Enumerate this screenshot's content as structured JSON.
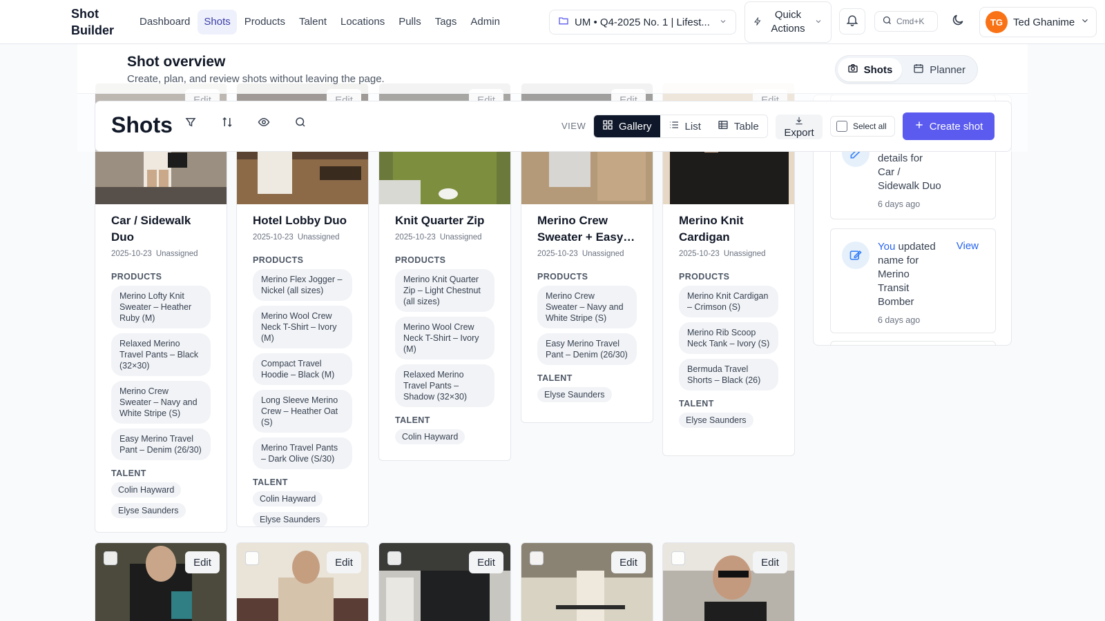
{
  "app": {
    "name": "Shot Builder"
  },
  "nav": {
    "links": [
      "Dashboard",
      "Shots",
      "Products",
      "Talent",
      "Locations",
      "Pulls",
      "Tags",
      "Admin"
    ],
    "active": "Shots"
  },
  "project_selector": {
    "value": "UM • Q4-2025 No. 1 | Lifest..."
  },
  "quick_actions": {
    "label": "Quick Actions"
  },
  "search": {
    "shortcut": "Cmd+K"
  },
  "user": {
    "initials": "TG",
    "name": "Ted Ghanime"
  },
  "page": {
    "title": "Shot overview",
    "subtitle": "Create, plan, and review shots without leaving the page.",
    "mode_shots": "Shots",
    "mode_planner": "Planner"
  },
  "toolbar": {
    "title": "Shots",
    "view_label": "VIEW",
    "views": [
      "Gallery",
      "List",
      "Table"
    ],
    "active_view": "Gallery",
    "export_label": "Export",
    "select_all_label": "Select all",
    "create_label": "Create shot"
  },
  "labels": {
    "products": "PRODUCTS",
    "talent": "TALENT",
    "edit": "Edit"
  },
  "cards": [
    {
      "title": "Car / Sidewalk Duo",
      "date": "2025-10-23",
      "assignee": "Unassigned",
      "products": [
        "Merino Lofty Knit Sweater – Heather Ruby (M)",
        "Relaxed Merino Travel Pants – Black (32×30)",
        "Merino Crew Sweater – Navy and White Stripe (S)",
        "Easy Merino Travel Pant – Denim (26/30)"
      ],
      "talent": [
        "Colin Hayward",
        "Elyse Saunders"
      ]
    },
    {
      "title": "Hotel Lobby Duo",
      "date": "2025-10-23",
      "assignee": "Unassigned",
      "products": [
        "Merino Flex Jogger – Nickel (all sizes)",
        "Merino Wool Crew Neck T-Shirt – Ivory (M)",
        "Compact Travel Hoodie – Black (M)",
        "Long Sleeve Merino Crew – Heather Oat (S)",
        "Merino Travel Pants – Dark Olive (S/30)"
      ],
      "talent": [
        "Colin Hayward",
        "Elyse Saunders"
      ]
    },
    {
      "title": "Knit Quarter Zip",
      "date": "2025-10-23",
      "assignee": "Unassigned",
      "products": [
        "Merino Knit Quarter Zip – Light Chestnut (all sizes)",
        "Merino Wool Crew Neck T-Shirt – Ivory (M)",
        "Relaxed Merino Travel Pants – Shadow (32×30)"
      ],
      "talent": [
        "Colin Hayward"
      ]
    },
    {
      "title": "Merino Crew Sweater + Easy…",
      "date": "2025-10-23",
      "assignee": "Unassigned",
      "products": [
        "Merino Crew Sweater – Navy and White Stripe (S)",
        "Easy Merino Travel Pant – Denim (26/30)"
      ],
      "talent": [
        "Elyse Saunders"
      ]
    },
    {
      "title": "Merino Knit Cardigan",
      "date": "2025-10-23",
      "assignee": "Unassigned",
      "products": [
        "Merino Knit Cardigan – Crimson (S)",
        "Merino Rib Scoop Neck Tank – Ivory (S)",
        "Bermuda Travel Shorts – Black (26)"
      ],
      "talent": [
        "Elyse Saunders"
      ]
    }
  ],
  "activity": [
    {
      "lines": [
        "details for",
        "Car /",
        "Sidewalk Duo"
      ],
      "time": "6 days ago"
    },
    {
      "actor": "You",
      "lines_after": [
        "updated",
        "name for",
        "Merino",
        "Transit",
        "Bomber"
      ],
      "time": "6 days ago",
      "view_label": "View"
    }
  ],
  "colors": {
    "primary": "#5b5bf0",
    "nav_active_bg": "#eef0fb",
    "avatar": "#f97316",
    "link": "#2563eb"
  }
}
